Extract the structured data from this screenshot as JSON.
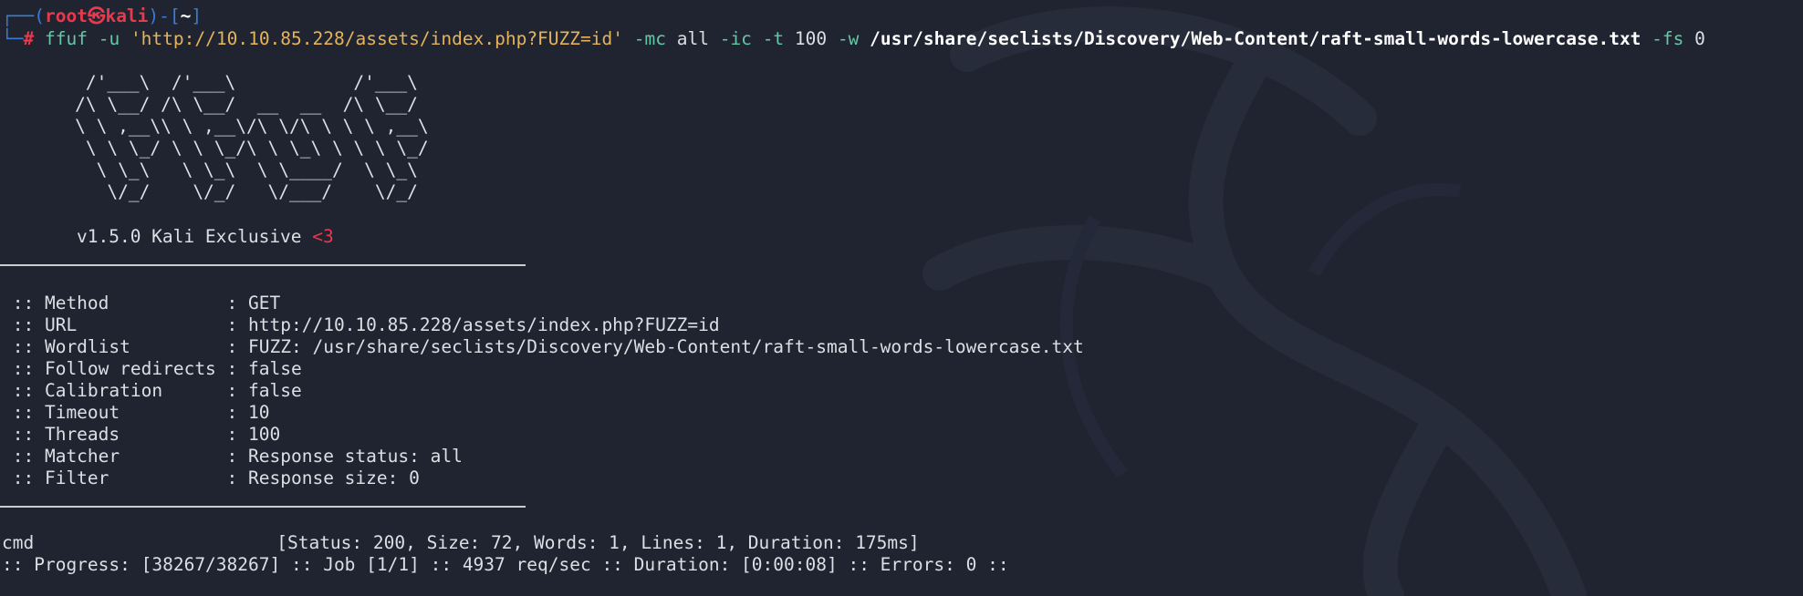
{
  "prompt": {
    "user": "root",
    "host": "kali",
    "cwd": "~",
    "symbol": "#"
  },
  "command": {
    "program": "ffuf",
    "flag_u": "-u",
    "url_arg": "'http://10.10.85.228/assets/index.php?FUZZ=id'",
    "flag_mc": "-mc",
    "mc_value": "all",
    "flag_ic": "-ic",
    "flag_t": "-t",
    "t_value": "100",
    "flag_w": "-w",
    "wordlist_path": "/usr/share/seclists/Discovery/Web-Content/raft-small-words-lowercase.txt",
    "flag_fs": "-fs",
    "fs_value": "0"
  },
  "banner": {
    "ascii_lines": [
      "        /'___\\  /'___\\           /'___\\",
      "       /\\ \\__/ /\\ \\__/  __  __  /\\ \\__/",
      "       \\ \\ ,__\\\\ \\ ,__\\/\\ \\/\\ \\ \\ \\ ,__\\",
      "        \\ \\ \\_/ \\ \\ \\_/\\ \\ \\_\\ \\ \\ \\ \\_/",
      "         \\ \\_\\   \\ \\_\\  \\ \\____/  \\ \\_\\",
      "          \\/_/    \\/_/   \\/___/    \\/_/"
    ],
    "version": "v1.5.0 Kali Exclusive",
    "heart": "<3"
  },
  "config": [
    {
      "key": " :: Method           ",
      "value": ": GET"
    },
    {
      "key": " :: URL              ",
      "value": ": http://10.10.85.228/assets/index.php?FUZZ=id"
    },
    {
      "key": " :: Wordlist         ",
      "value": ": FUZZ: /usr/share/seclists/Discovery/Web-Content/raft-small-words-lowercase.txt"
    },
    {
      "key": " :: Follow redirects ",
      "value": ": false"
    },
    {
      "key": " :: Calibration      ",
      "value": ": false"
    },
    {
      "key": " :: Timeout          ",
      "value": ": 10"
    },
    {
      "key": " :: Threads          ",
      "value": ": 100"
    },
    {
      "key": " :: Matcher          ",
      "value": ": Response status: all"
    },
    {
      "key": " :: Filter           ",
      "value": ": Response size: 0"
    }
  ],
  "result": {
    "word": "cmd",
    "details": "[Status: 200, Size: 72, Words: 1, Lines: 1, Duration: 175ms]"
  },
  "progress": {
    "text": ":: Progress: [38267/38267] :: Job [1/1] :: 4937 req/sec :: Duration: [0:00:08] :: Errors: 0 ::"
  },
  "colors": {
    "background": "#1f2430",
    "prompt_frame": "#3a7bd5",
    "prompt_user": "#e8394d",
    "flag": "#66c7a4",
    "string": "#e6b35a"
  }
}
